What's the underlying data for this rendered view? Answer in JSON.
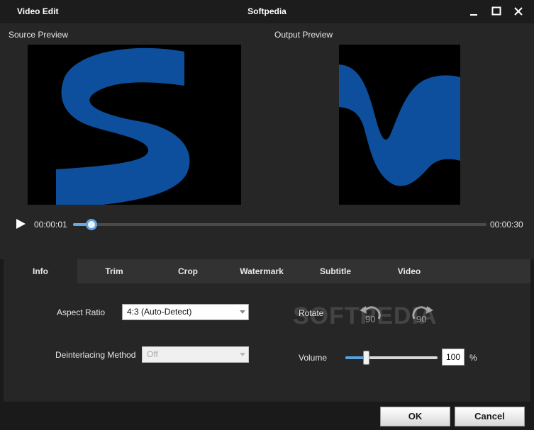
{
  "window": {
    "title": "Video Edit",
    "app_title": "Softpedia",
    "controls": [
      "minimize-icon",
      "maximize-icon",
      "close-icon"
    ]
  },
  "preview": {
    "source_label": "Source Preview",
    "output_label": "Output Preview",
    "source_glyph": "S",
    "video_bg": "#000000",
    "glyph_color": "#0d4f9c"
  },
  "playback": {
    "current_time": "00:00:01",
    "total_time": "00:00:30",
    "progress_fraction": 0.044,
    "accent": "#5ea3dd"
  },
  "tabs": [
    {
      "label": "Info",
      "active": true
    },
    {
      "label": "Trim",
      "active": false
    },
    {
      "label": "Crop",
      "active": false
    },
    {
      "label": "Watermark",
      "active": false
    },
    {
      "label": "Subtitle",
      "active": false
    },
    {
      "label": "Video",
      "active": false
    }
  ],
  "info": {
    "aspect_ratio_label": "Aspect Ratio",
    "aspect_ratio_value": "4:3 (Auto-Detect)",
    "deinterlacing_label": "Deinterlacing Method",
    "deinterlacing_value": "Off",
    "rotate_label": "Rotate",
    "rotate_left_value": "90",
    "rotate_right_value": "90",
    "volume_label": "Volume",
    "volume_value": "100",
    "volume_unit": "%",
    "volume_fraction": 0.22
  },
  "watermark_text": "SOFTPEDIA",
  "footer": {
    "ok_label": "OK",
    "cancel_label": "Cancel"
  }
}
